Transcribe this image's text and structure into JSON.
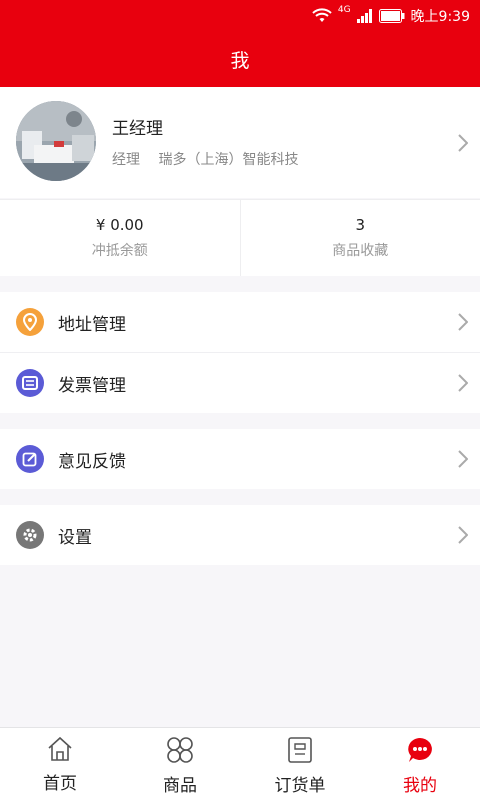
{
  "status_bar": {
    "network": "4G",
    "time": "晚上9:39"
  },
  "header": {
    "title": "我"
  },
  "profile": {
    "name": "王经理",
    "role": "经理",
    "company": "瑞多（上海）智能科技"
  },
  "stats": [
    {
      "value": "¥ 0.00",
      "label": "冲抵余额"
    },
    {
      "value": "3",
      "label": "商品收藏"
    }
  ],
  "menu": [
    {
      "label": "地址管理",
      "icon": "location-icon",
      "color": "#f5a13b"
    },
    {
      "label": "发票管理",
      "icon": "ticket-icon",
      "color": "#5b5bd6"
    },
    {
      "label": "意见反馈",
      "icon": "edit-icon",
      "color": "#5b5bd6"
    },
    {
      "label": "设置",
      "icon": "gear-icon",
      "color": "#777777"
    }
  ],
  "tabs": [
    {
      "label": "首页",
      "icon": "home-icon"
    },
    {
      "label": "商品",
      "icon": "grid-icon"
    },
    {
      "label": "订货单",
      "icon": "order-icon"
    },
    {
      "label": "我的",
      "icon": "chat-icon",
      "active": true
    }
  ],
  "colors": {
    "brand": "#e8000e",
    "background": "#f7f6f9"
  }
}
